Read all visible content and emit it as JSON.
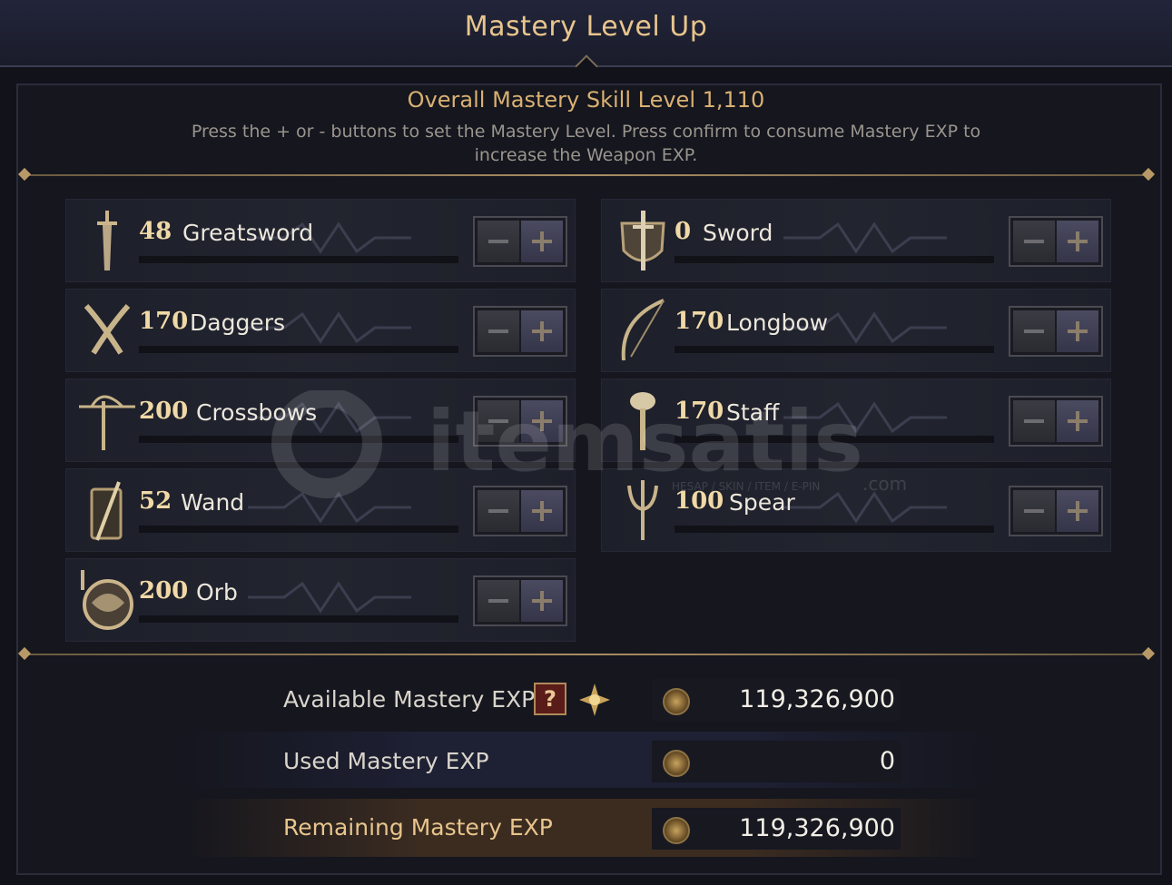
{
  "window": {
    "title": "Mastery Level Up"
  },
  "header": {
    "overall": "Overall Mastery Skill Level 1,110",
    "hint": "Press the + or - buttons to set the Mastery Level. Press confirm to consume Mastery EXP to increase the Weapon EXP."
  },
  "weapons": {
    "greatsword": {
      "level": "48",
      "name": "Greatsword",
      "icon": "greatsword-icon"
    },
    "daggers": {
      "level": "170",
      "name": "Daggers",
      "icon": "daggers-icon"
    },
    "crossbows": {
      "level": "200",
      "name": "Crossbows",
      "icon": "crossbow-icon"
    },
    "wand": {
      "level": "52",
      "name": "Wand",
      "icon": "wand-icon"
    },
    "orb": {
      "level": "200",
      "name": "Orb",
      "icon": "orb-icon"
    },
    "sword": {
      "level": "0",
      "name": "Sword",
      "icon": "sword-shield-icon"
    },
    "longbow": {
      "level": "170",
      "name": "Longbow",
      "icon": "longbow-icon"
    },
    "staff": {
      "level": "170",
      "name": "Staff",
      "icon": "staff-icon"
    },
    "spear": {
      "level": "100",
      "name": "Spear",
      "icon": "spear-icon"
    }
  },
  "exp": {
    "available_label": "Available Mastery EXP",
    "available_value": "119,326,900",
    "used_label": "Used Mastery EXP",
    "used_value": "0",
    "remaining_label": "Remaining Mastery EXP",
    "remaining_value": "119,326,900",
    "help_glyph": "?"
  },
  "watermark": {
    "brand": "itemsatis",
    "tagline": "HESAP / SKIN / ITEM / E-PIN",
    "tld": ".com"
  },
  "colors": {
    "gold": "#e8c58d",
    "panel": "#15161e",
    "accent": "#d9b072"
  }
}
